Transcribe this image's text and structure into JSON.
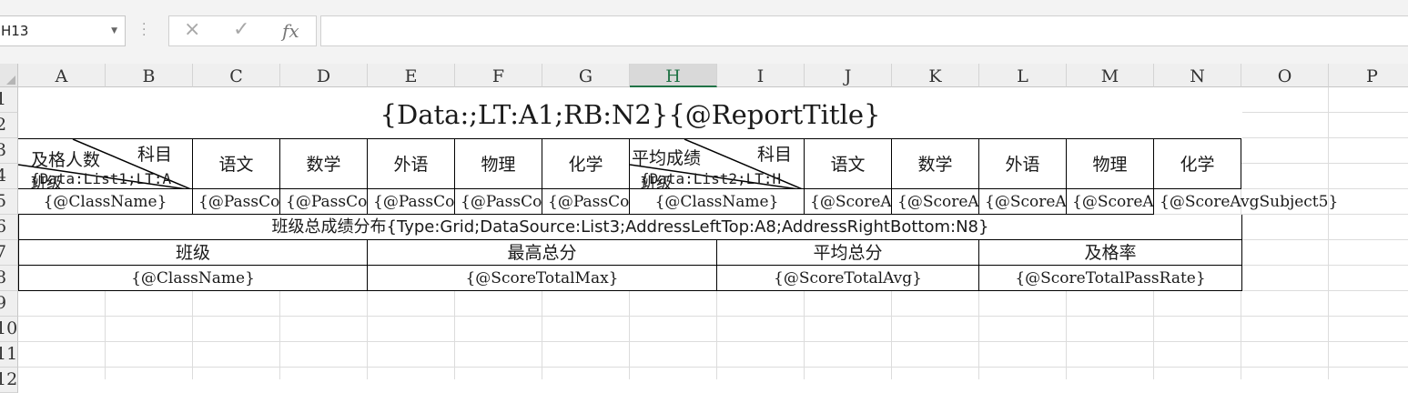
{
  "formula_bar": {
    "name_box": "H13",
    "cancel_icon": "×",
    "enter_icon": "✓",
    "function_icon": "fx",
    "formula": ""
  },
  "columns": [
    "A",
    "B",
    "C",
    "D",
    "E",
    "F",
    "G",
    "H",
    "I",
    "J",
    "K",
    "L",
    "M",
    "N",
    "O",
    "P"
  ],
  "rows": [
    "1",
    "2",
    "3",
    "4",
    "5",
    "6",
    "7",
    "8",
    "9",
    "10",
    "11",
    "12"
  ],
  "selected_column": "H",
  "sheet": {
    "title": "{Data:;LT:A1;RB:N2}{@ReportTitle}",
    "left_header": {
      "corner_top": "科目",
      "corner_mid": "及格人数",
      "corner_bottom": "班级",
      "list_tag": "{Data:List1;LT:A",
      "subjects": [
        "语文",
        "数学",
        "外语",
        "物理",
        "化学"
      ]
    },
    "right_header": {
      "corner_top": "科目",
      "corner_mid": "平均成绩",
      "corner_bottom": "班级",
      "list_tag": "{Data:List2;LT:H",
      "subjects": [
        "语文",
        "数学",
        "外语",
        "物理",
        "化学"
      ]
    },
    "row5": {
      "left_class": "{@ClassName}",
      "pass_cells": [
        "{@PassCou",
        "{@PassCou",
        "{@PassCou",
        "{@PassCou",
        "{@PassCou"
      ],
      "right_class": "{@ClassName}",
      "score_cells": [
        "{@ScoreAv",
        "{@ScoreAv",
        "{@ScoreAv",
        "{@ScoreAv"
      ],
      "score_last": "{@ScoreAvgSubject5}"
    },
    "row6": "班级总成绩分布{Type:Grid;DataSource:List3;AddressLeftTop:A8;AddressRightBottom:N8}",
    "row7": [
      "班级",
      "最高总分",
      "平均总分",
      "及格率"
    ],
    "row8": [
      "{@ClassName}",
      "{@ScoreTotalMax}",
      "{@ScoreTotalAvg}",
      "{@ScoreTotalPassRate}"
    ]
  }
}
